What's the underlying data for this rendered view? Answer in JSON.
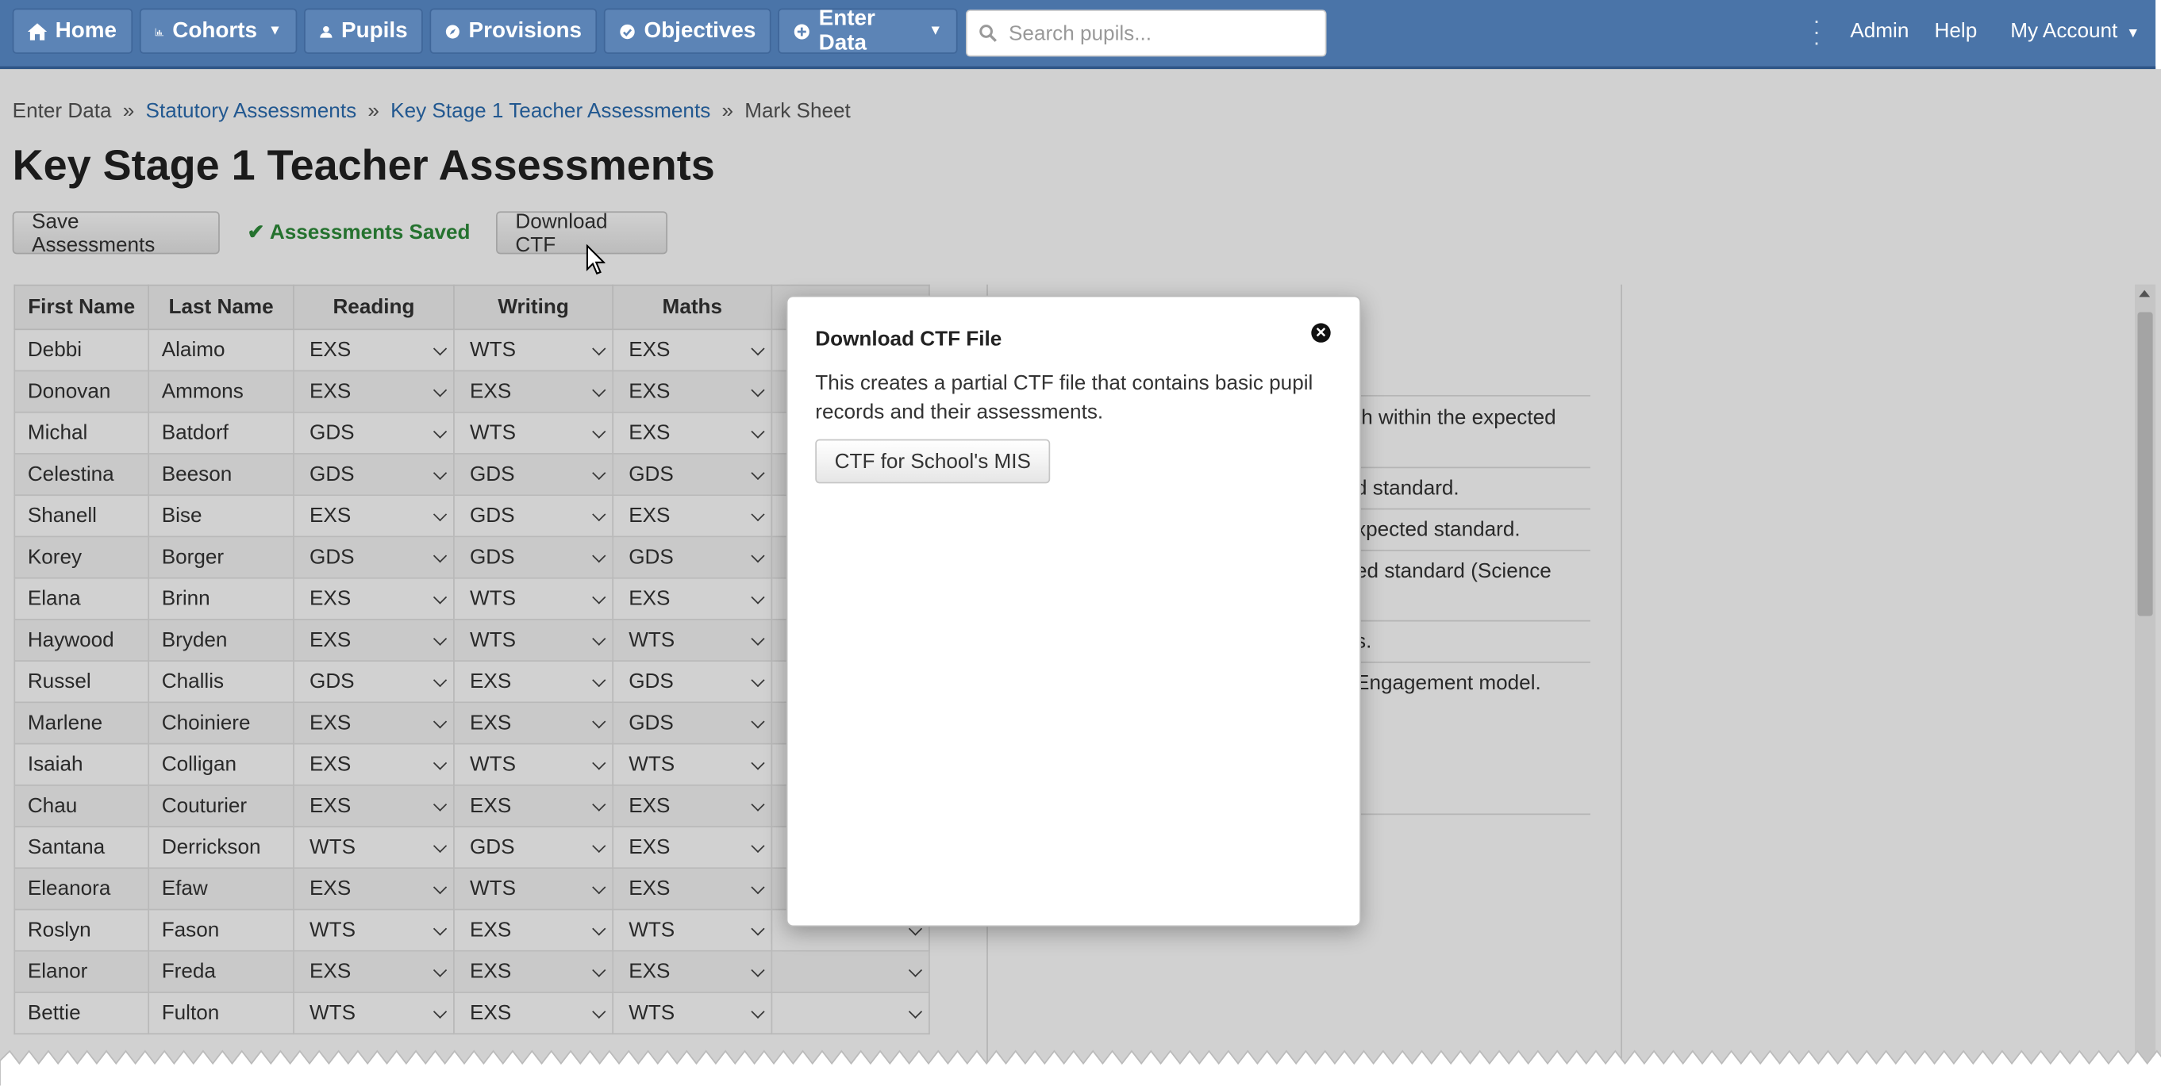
{
  "nav": {
    "home": "Home",
    "cohorts": "Cohorts",
    "pupils": "Pupils",
    "provisions": "Provisions",
    "objectives": "Objectives",
    "enter_data": "Enter Data",
    "search_placeholder": "Search pupils...",
    "admin": "Admin",
    "help": "Help",
    "my_account": "My Account"
  },
  "breadcrumb": {
    "item1": "Enter Data",
    "item2": "Statutory Assessments",
    "item3": "Key Stage 1 Teacher Assessments",
    "item4": "Mark Sheet",
    "separator": "»"
  },
  "page": {
    "title": "Key Stage 1 Teacher Assessments",
    "save_button": "Save Assessments",
    "saved_status": "Assessments Saved",
    "download_button": "Download CTF"
  },
  "table": {
    "headers": [
      "First Name",
      "Last Name",
      "Reading",
      "Writing",
      "Maths"
    ],
    "rows": [
      [
        "Debbi",
        "Alaimo",
        "EXS",
        "WTS",
        "EXS"
      ],
      [
        "Donovan",
        "Ammons",
        "EXS",
        "EXS",
        "EXS"
      ],
      [
        "Michal",
        "Batdorf",
        "GDS",
        "WTS",
        "EXS"
      ],
      [
        "Celestina",
        "Beeson",
        "GDS",
        "GDS",
        "GDS"
      ],
      [
        "Shanell",
        "Bise",
        "EXS",
        "GDS",
        "EXS"
      ],
      [
        "Korey",
        "Borger",
        "GDS",
        "GDS",
        "GDS"
      ],
      [
        "Elana",
        "Brinn",
        "EXS",
        "WTS",
        "EXS"
      ],
      [
        "Haywood",
        "Bryden",
        "EXS",
        "WTS",
        "WTS"
      ],
      [
        "Russel",
        "Challis",
        "GDS",
        "EXS",
        "GDS"
      ],
      [
        "Marlene",
        "Choiniere",
        "EXS",
        "EXS",
        "GDS"
      ],
      [
        "Isaiah",
        "Colligan",
        "EXS",
        "WTS",
        "WTS"
      ],
      [
        "Chau",
        "Couturier",
        "EXS",
        "EXS",
        "EXS"
      ],
      [
        "Santana",
        "Derrickson",
        "WTS",
        "GDS",
        "EXS"
      ],
      [
        "Eleanora",
        "Efaw",
        "EXS",
        "WTS",
        "EXS"
      ],
      [
        "Roslyn",
        "Fason",
        "WTS",
        "EXS",
        "WTS"
      ],
      [
        "Elanor",
        "Freda",
        "EXS",
        "EXS",
        "EXS"
      ],
      [
        "Bettie",
        "Fulton",
        "WTS",
        "EXS",
        "WTS"
      ]
    ]
  },
  "side_panel": {
    "line1a": "th within the expected",
    "line2": "d standard.",
    "line3": "xpected standard.",
    "line4": "ed standard (Science",
    "line5": "s.",
    "line6": "Engagement model."
  },
  "modal": {
    "title": "Download CTF File",
    "body": "This creates a partial CTF file that contains basic pupil records and their assessments.",
    "button": "CTF for School's MIS"
  }
}
